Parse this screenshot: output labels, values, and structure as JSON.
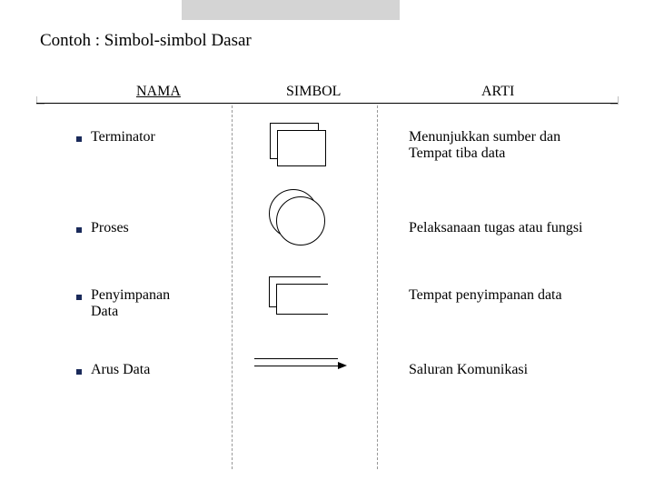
{
  "title": "Contoh : Simbol-simbol Dasar",
  "headers": {
    "nama": "NAMA",
    "simbol": "SIMBOL",
    "arti": "ARTI"
  },
  "rows": [
    {
      "nama": "Terminator",
      "arti": "Menunjukkan sumber dan\nTempat tiba data"
    },
    {
      "nama": "Proses",
      "arti": "Pelaksanaan tugas atau fungsi"
    },
    {
      "nama": "Penyimpanan\nData",
      "arti": "Tempat penyimpanan data"
    },
    {
      "nama": "Arus Data",
      "arti": "Saluran Komunikasi"
    }
  ]
}
